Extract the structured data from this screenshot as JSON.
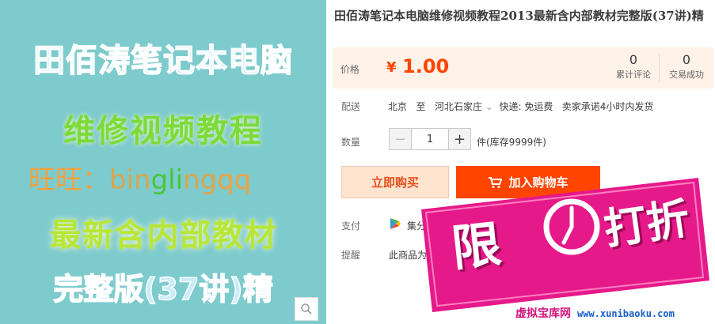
{
  "image_text": {
    "line1": "田佰涛笔记本电脑",
    "line2": "维修视频教程",
    "line3_prefix": "旺旺：",
    "line3_id": [
      "bin",
      "gli",
      "ng",
      "qq"
    ],
    "line4": "最新含内部教材",
    "line5": "完整版(37讲)精"
  },
  "title": "田佰涛笔记本电脑维修视频教程2013最新含内部教材完整版(37讲)精",
  "price": {
    "label": "价格",
    "symbol": "¥",
    "value": "1.00"
  },
  "stats": {
    "reviews_count": "0",
    "reviews_label": "累计评论",
    "trades_count": "0",
    "trades_label": "交易成功"
  },
  "delivery": {
    "label": "配送",
    "from": "北京",
    "to_word": "至",
    "to": "河北石家庄",
    "chevron": "⌄",
    "shipping": "快递: 免运费",
    "promise": "卖家承诺4小时内发货"
  },
  "quantity": {
    "label": "数量",
    "minus": "−",
    "value": "1",
    "plus": "+",
    "stock": "件(库存9999件)"
  },
  "buttons": {
    "buy_now": "立即购买",
    "add_cart": "加入购物车"
  },
  "payment": {
    "label": "支付",
    "text": "集分"
  },
  "reminder": {
    "label": "提醒",
    "text": "此商品为"
  },
  "promo": {
    "xian": "限",
    "dazhe": "打折",
    "site_name": "虚拟宝库网",
    "site_url": "www.xunibaoku.com"
  },
  "colors": {
    "accent": "#ff4400",
    "price": "#ff4400",
    "image_bg": "#7ecbcd",
    "promo_pink": "#e6198a"
  },
  "icons": {
    "zoom": "search-icon",
    "cart": "cart-icon",
    "pay": "google-play-style-icon"
  }
}
